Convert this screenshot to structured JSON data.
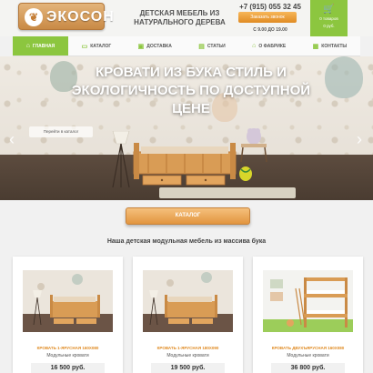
{
  "header": {
    "logo_text": "ЭКОСОН",
    "tagline": "ДЕТСКАЯ МЕБЕЛЬ ИЗ НАТУРАЛЬНОГО ДЕРЕВА",
    "phone": "+7 (915) 055 32 45",
    "callback_label": "Заказать звонок",
    "hours": "С 9.00 ДО 19.00",
    "cart_line1": "0 товаров",
    "cart_line2": "0 руб."
  },
  "nav": {
    "items": [
      {
        "label": "ГЛАВНАЯ",
        "icon": "home-icon"
      },
      {
        "label": "КАТАЛОГ",
        "icon": "catalog-icon"
      },
      {
        "label": "ДОСТАВКА",
        "icon": "truck-icon"
      },
      {
        "label": "СТАТЬИ",
        "icon": "articles-icon"
      },
      {
        "label": "О ФАБРИКЕ",
        "icon": "factory-icon"
      },
      {
        "label": "КОНТАКТЫ",
        "icon": "contacts-icon"
      }
    ]
  },
  "hero": {
    "title": "КРОВАТИ ИЗ БУКА СТИЛЬ И ЭКОЛОГИЧНОСТЬ ПО ДОСТУПНОЙ ЦЕНЕ",
    "button_label": "Перейти в каталог"
  },
  "catalog_button": "КАТАЛОГ",
  "section_title": "Наша детская модульная мебель из массива бука",
  "products": [
    {
      "title": "КРОВАТЬ 1-ЯРУСНАЯ 160Х080",
      "subtitle": "Модульные кровати",
      "price": "16 500 руб."
    },
    {
      "title": "КРОВАТЬ 1-ЯРУСНАЯ 180Х090",
      "subtitle": "Модульные кровати",
      "price": "19 500 руб."
    },
    {
      "title": "КРОВАТЬ ДВУХЪЯРУСНАЯ 160Х080",
      "subtitle": "Модульные кровати",
      "price": "36 800 руб."
    }
  ],
  "colors": {
    "accent_green": "#8cc63f",
    "accent_orange": "#e08b23"
  }
}
